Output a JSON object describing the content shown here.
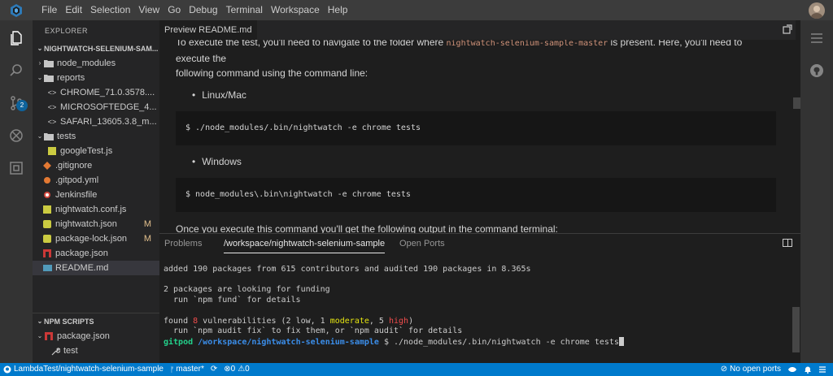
{
  "menubar": {
    "items": [
      "File",
      "Edit",
      "Selection",
      "View",
      "Go",
      "Debug",
      "Terminal",
      "Workspace",
      "Help"
    ]
  },
  "activitybar": {
    "badge": "2"
  },
  "sidebar": {
    "title": "EXPLORER",
    "workspace": "NIGHTWATCH-SELENIUM-SAM...",
    "tree": [
      {
        "label": "node_modules",
        "twistie": "›",
        "icon": "folder-icon"
      },
      {
        "label": "reports",
        "twistie": "⌄",
        "icon": "folder-icon"
      },
      {
        "label": "CHROME_71.0.3578....",
        "icon": "code-file-icon"
      },
      {
        "label": "MICROSOFTEDGE_4...",
        "icon": "code-file-icon"
      },
      {
        "label": "SAFARI_13605.3.8_m...",
        "icon": "code-file-icon"
      },
      {
        "label": "tests",
        "twistie": "⌄",
        "icon": "folder-icon"
      },
      {
        "label": "googleTest.js",
        "icon": "js-file-icon"
      },
      {
        "label": ".gitignore",
        "icon": "git-file-icon"
      },
      {
        "label": ".gitpod.yml",
        "icon": "yml-file-icon"
      },
      {
        "label": "Jenkinsfile",
        "icon": "jenkins-file-icon"
      },
      {
        "label": "nightwatch.conf.js",
        "icon": "js-file-icon"
      },
      {
        "label": "nightwatch.json",
        "icon": "json-file-icon",
        "status": "M"
      },
      {
        "label": "package-lock.json",
        "icon": "json-file-icon",
        "status": "M"
      },
      {
        "label": "package.json",
        "icon": "npm-file-icon"
      },
      {
        "label": "README.md",
        "icon": "md-file-icon"
      }
    ],
    "npm": {
      "title": "NPM SCRIPTS",
      "package": "package.json",
      "script": "test"
    }
  },
  "editor": {
    "tab": "Preview README.md",
    "para1_before": "To execute the test, you'll need to navigate to the folder where ",
    "para1_code": "nightwatch-selenium-sample-master",
    "para1_after": " is present. Here, you'll need to execute the",
    "para1_line2": "following command using the command line:",
    "bullet1": "Linux/Mac",
    "code1": "$ ./node_modules/.bin/nightwatch -e chrome tests",
    "bullet2": "Windows",
    "code2": "$ node_modules\\.bin\\nightwatch -e chrome tests",
    "para2": "Once you execute this command you'll get the following output in the command terminal:"
  },
  "panel": {
    "tabs": [
      "Problems",
      "/workspace/nightwatch-selenium-sample",
      "Open Ports"
    ],
    "active_tab": 1,
    "terminal": {
      "l1": "added 190 packages from 615 contributors and audited 190 packages in 8.365s",
      "l2": "2 packages are looking for funding",
      "l3": "  run `npm fund` for details",
      "l4a": "found ",
      "l4b": "8",
      "l4c": " vulnerabilities (2 low, 1 ",
      "l4d": "moderate",
      "l4e": ", 5 ",
      "l4f": "high",
      "l4g": ")",
      "l5": "  run `npm audit fix` to fix them, or `npm audit` for details",
      "prompt_user": "gitpod",
      "prompt_path": "/workspace/nightwatch-selenium-sample",
      "prompt_cmd": " $ ./node_modules/.bin/nightwatch -e chrome tests"
    }
  },
  "statusbar": {
    "repo": "LambdaTest/nightwatch-selenium-sample",
    "branch": "master*",
    "errors": "0",
    "warnings": "0",
    "ports": "No open ports"
  },
  "colors": {
    "accent": "#007acc",
    "modified": "#e2c08d",
    "badge": "#0e639c"
  }
}
